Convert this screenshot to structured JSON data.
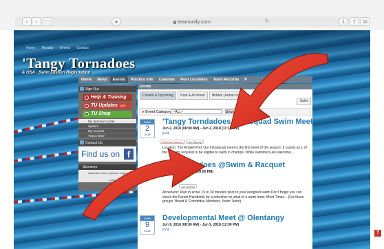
{
  "browser": {
    "url": "teamunify.com"
  },
  "site": {
    "title": "'Tangy Tornadoes",
    "subtitle": "& OSA - Swim Lesson Registration",
    "top_links": [
      "Home",
      "Results",
      "Events",
      "Contact"
    ]
  },
  "nav": [
    "Home",
    "News",
    "Events",
    "Practice Info",
    "Calendar",
    "Pool Locations",
    "Team Records",
    "P"
  ],
  "sidebar": {
    "sign_out": "Sign Out",
    "help_training": "Help & Training",
    "tu_updates": "TU Updates",
    "tu_badge": "175",
    "tu_shop": "TU Shop",
    "sponsor_locker": "My Sponsor Locker",
    "system": "System",
    "my_account": "My Account",
    "team_admin": "Team Admin",
    "contact_us": "Contact Us",
    "find_us": "Find us on",
    "sponsors": "Sponsors",
    "advertise": "Advertise Here | Sponsor Login",
    "view_all": "+View All"
  },
  "events": {
    "header": "Events",
    "tabs": [
      "Current & Upcoming",
      "Past & Archived",
      "Hidden (Admin only)"
    ],
    "add_label": "Sales",
    "filter_label": "Event Category:",
    "filter_value": "--ALL--",
    "search_label": "Search",
    "items": [
      {
        "month": "June",
        "day": "2",
        "year": "2018",
        "title": "'Tangy Torndadoes Intrasquad Swim Meet",
        "datetime": "Jun 2, 2018 (08:00 AM) - Jun 2, 2018 (11:15 AM)",
        "edit": "[Edit]",
        "pill1": "Edit Commitment",
        "pill2": "Job Signup",
        "desc": "Location: The Rowell Pool Our intrasquad meet is the first meet of the season. It counts as 1 of the 2 meets required to be eligible to swim in champs. While swimmers are welcome,..."
      },
      {
        "title": "eet: Tornadoes @Swim & Racquet",
        "datetime": "00 PM) - Jun 5, 2018 (09:00 PM)",
        "pill": "Job Signup",
        "desc": "Annehurst: Plan to arrive 15 to 30 minutes prior to your assigned warm Don't forget you can check the Parent Handbook for a refresher on what of a swim meet. Meet Times... (For these groups: Board & Committee Members, Swim Team)"
      },
      {
        "month": "June",
        "day": "9",
        "year": "2018",
        "title": "Developmental Meet @ Olentangy",
        "datetime": "Jun 9, 2018 (08:00 AM) - Jun 9, 2018 (12:00 PM)",
        "edit": "[Edit]"
      }
    ]
  }
}
